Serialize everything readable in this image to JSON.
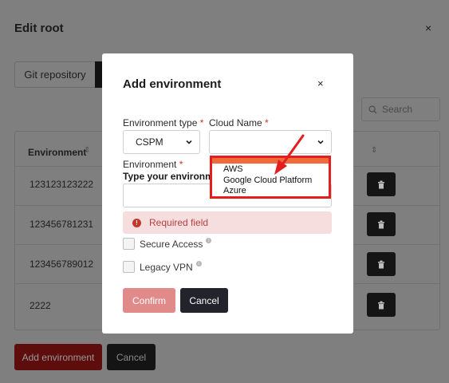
{
  "background": {
    "title": "Edit root",
    "close_glyph": "×",
    "tab_git": "Git repository",
    "search_placeholder": "Search",
    "table_header": "Environment",
    "rows": [
      "123123123222",
      "123456781231",
      "123456789012",
      "2222"
    ],
    "add_button": "Add environment",
    "cancel_button": "Cancel"
  },
  "modal": {
    "title": "Add environment",
    "close_glyph": "×",
    "env_type_label": "Environment type",
    "env_type_value": "CSPM",
    "cloud_name_label": "Cloud Name",
    "required_mark": "*",
    "environment_label": "Environment",
    "environment_sublabel": "Type your environment",
    "error_text": "Required field",
    "secure_access": "Secure Access",
    "legacy_vpn": "Legacy VPN",
    "confirm": "Confirm",
    "cancel": "Cancel"
  },
  "dropdown": {
    "options": [
      "AWS",
      "Google Cloud Platform",
      "Azure"
    ]
  },
  "colors": {
    "accent_red": "#e41e1e",
    "confirm_disabled": "#e08a8a",
    "highlight": "#f06a3a"
  },
  "icons": [
    "close-icon",
    "search-icon",
    "sort-icon",
    "trash-icon",
    "chevron-down-icon",
    "error-icon",
    "info-icon",
    "arrow-annotation"
  ]
}
